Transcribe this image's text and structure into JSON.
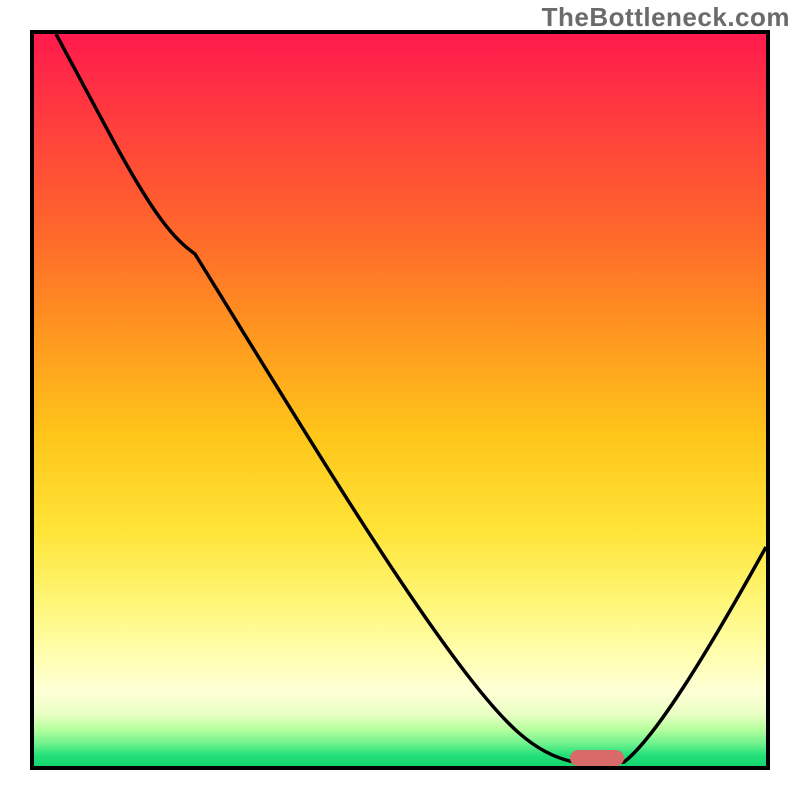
{
  "watermark": "TheBottleneck.com",
  "chart_data": {
    "type": "line",
    "title": "",
    "xlabel": "",
    "ylabel": "",
    "xlim": [
      0,
      100
    ],
    "ylim": [
      0,
      100
    ],
    "grid": false,
    "legend": false,
    "series": [
      {
        "name": "bottleneck-curve",
        "x": [
          3,
          10,
          18,
          22,
          58,
          68,
          75,
          80,
          100
        ],
        "y": [
          100,
          87,
          74,
          70,
          14,
          3,
          0,
          0,
          30
        ],
        "color": "#000000"
      }
    ],
    "marker": {
      "name": "optimal-marker",
      "x": 77,
      "y": 1,
      "color": "#d96a6a",
      "shape": "rounded-pill"
    },
    "gradient_stops": [
      {
        "pos": 0,
        "color": "#ff1a4d"
      },
      {
        "pos": 0.12,
        "color": "#ff3d3d"
      },
      {
        "pos": 0.28,
        "color": "#ff6a2a"
      },
      {
        "pos": 0.42,
        "color": "#ff9a1f"
      },
      {
        "pos": 0.55,
        "color": "#ffc61a"
      },
      {
        "pos": 0.68,
        "color": "#ffe438"
      },
      {
        "pos": 0.78,
        "color": "#fff77a"
      },
      {
        "pos": 0.86,
        "color": "#ffffb8"
      },
      {
        "pos": 0.9,
        "color": "#fdffd6"
      },
      {
        "pos": 0.93,
        "color": "#e8ffc2"
      },
      {
        "pos": 0.95,
        "color": "#b6ff9e"
      },
      {
        "pos": 0.97,
        "color": "#6cf28c"
      },
      {
        "pos": 0.985,
        "color": "#24e07a"
      },
      {
        "pos": 1.0,
        "color": "#14d66f"
      }
    ]
  }
}
